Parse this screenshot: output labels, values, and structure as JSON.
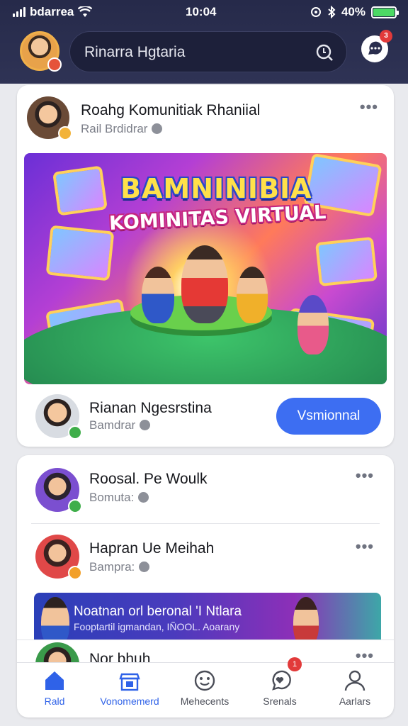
{
  "status_bar": {
    "carrier": "bdarrea",
    "time": "10:04",
    "battery": "40%"
  },
  "header": {
    "search_text": "Rinarra Hgtaria",
    "messages_badge": "3"
  },
  "featured_post": {
    "title": "Roahg Komunitiak Rhaniial",
    "subtitle": "Rail Brdidrar",
    "banner_title": "BAMNINIBIA",
    "banner_subtitle": "KOMINITAS VIRTUAL",
    "footer_name": "Rianan Ngesrstina",
    "footer_sub": "Bamdrar",
    "button_label": "Vsmionnal"
  },
  "list_items": [
    {
      "title": "Roosal. Pe Woulk",
      "subtitle": "Bomuta:"
    },
    {
      "title": "Hapran Ue Meihah",
      "subtitle": "Bampra:"
    },
    {
      "title": "Nor bhuh"
    }
  ],
  "promo": {
    "line1": "Noatnan orl beronal 'I Ntlara",
    "line2": "Fooptartil igmandan, IÑOOL. Aoarany"
  },
  "bottom_nav": [
    {
      "label": "Rald",
      "active": true
    },
    {
      "label": "Vonomemerd",
      "active": false
    },
    {
      "label": "Mehecents",
      "active": false
    },
    {
      "label": "Srenals",
      "active": false,
      "badge": "1"
    },
    {
      "label": "Aarlars",
      "active": false
    }
  ],
  "colors": {
    "accent": "#3d6ef2",
    "header_bg": "#2a2e4e",
    "badge_red": "#e23a3a"
  }
}
